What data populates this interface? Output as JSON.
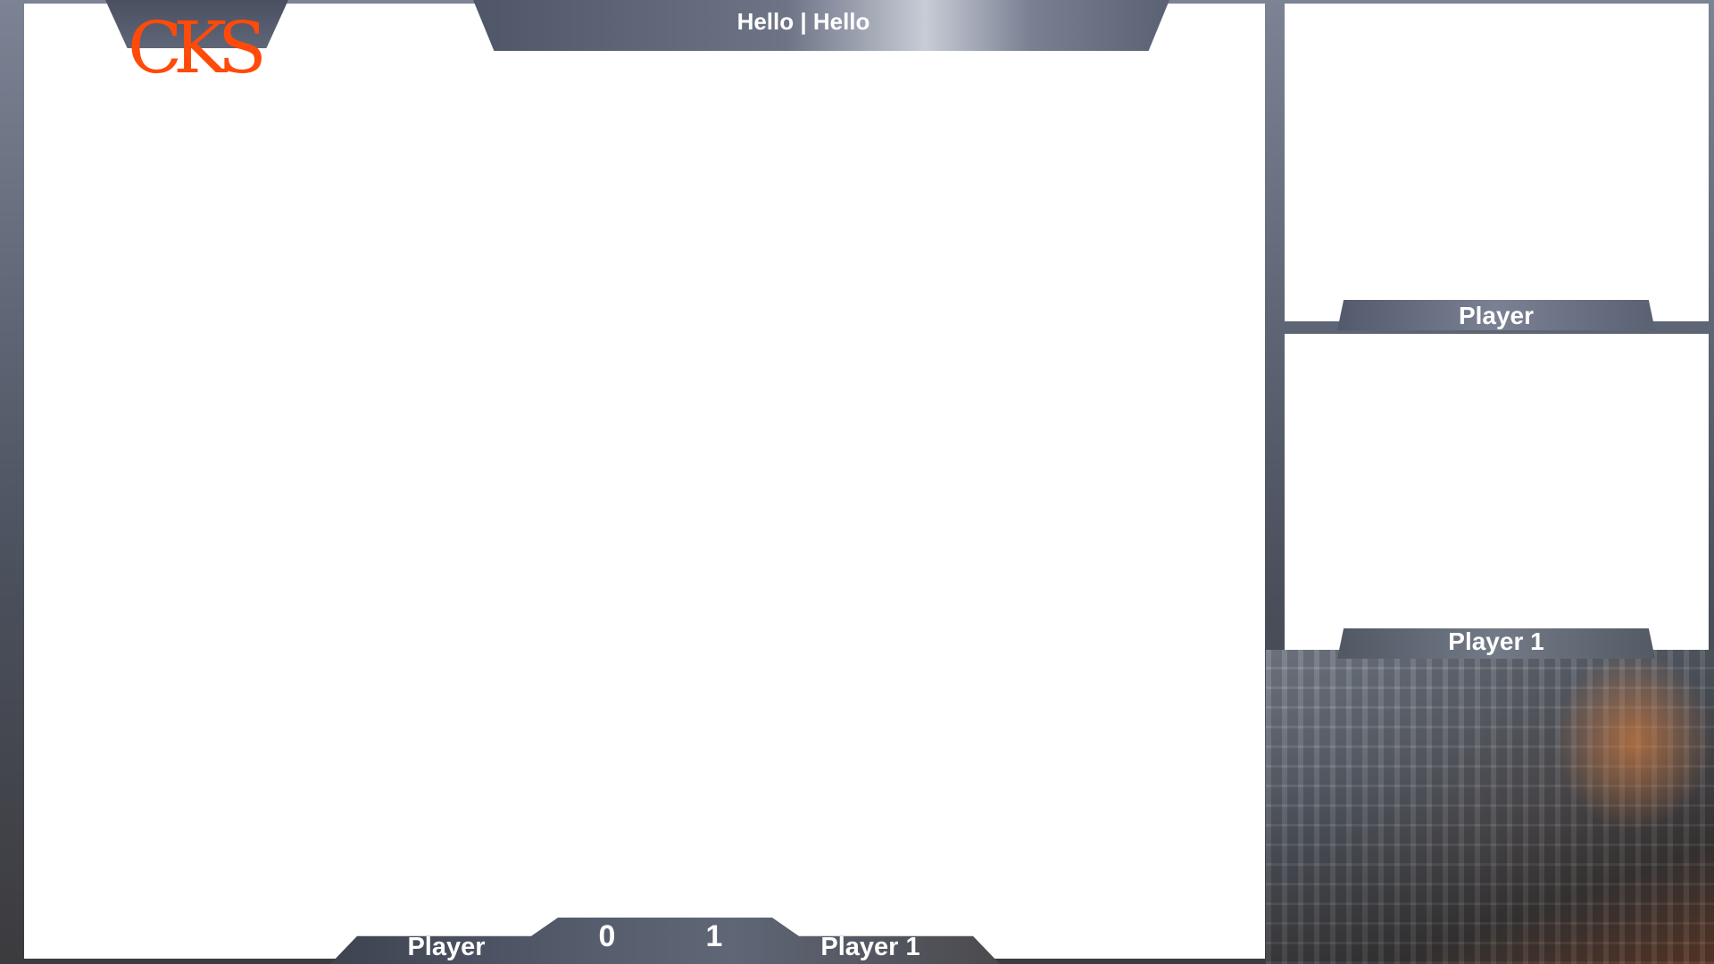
{
  "overlay": {
    "title": "Hello | Hello",
    "logo_text": "CKS",
    "accent_color": "#ff4a0a",
    "frame_color": "#ffffff"
  },
  "scoreboard": {
    "player1_name": "Player",
    "player1_score": "0",
    "player2_score": "1",
    "player2_name": "Player 1"
  },
  "side_cams": [
    {
      "label": "Player"
    },
    {
      "label": "Player 1"
    }
  ]
}
